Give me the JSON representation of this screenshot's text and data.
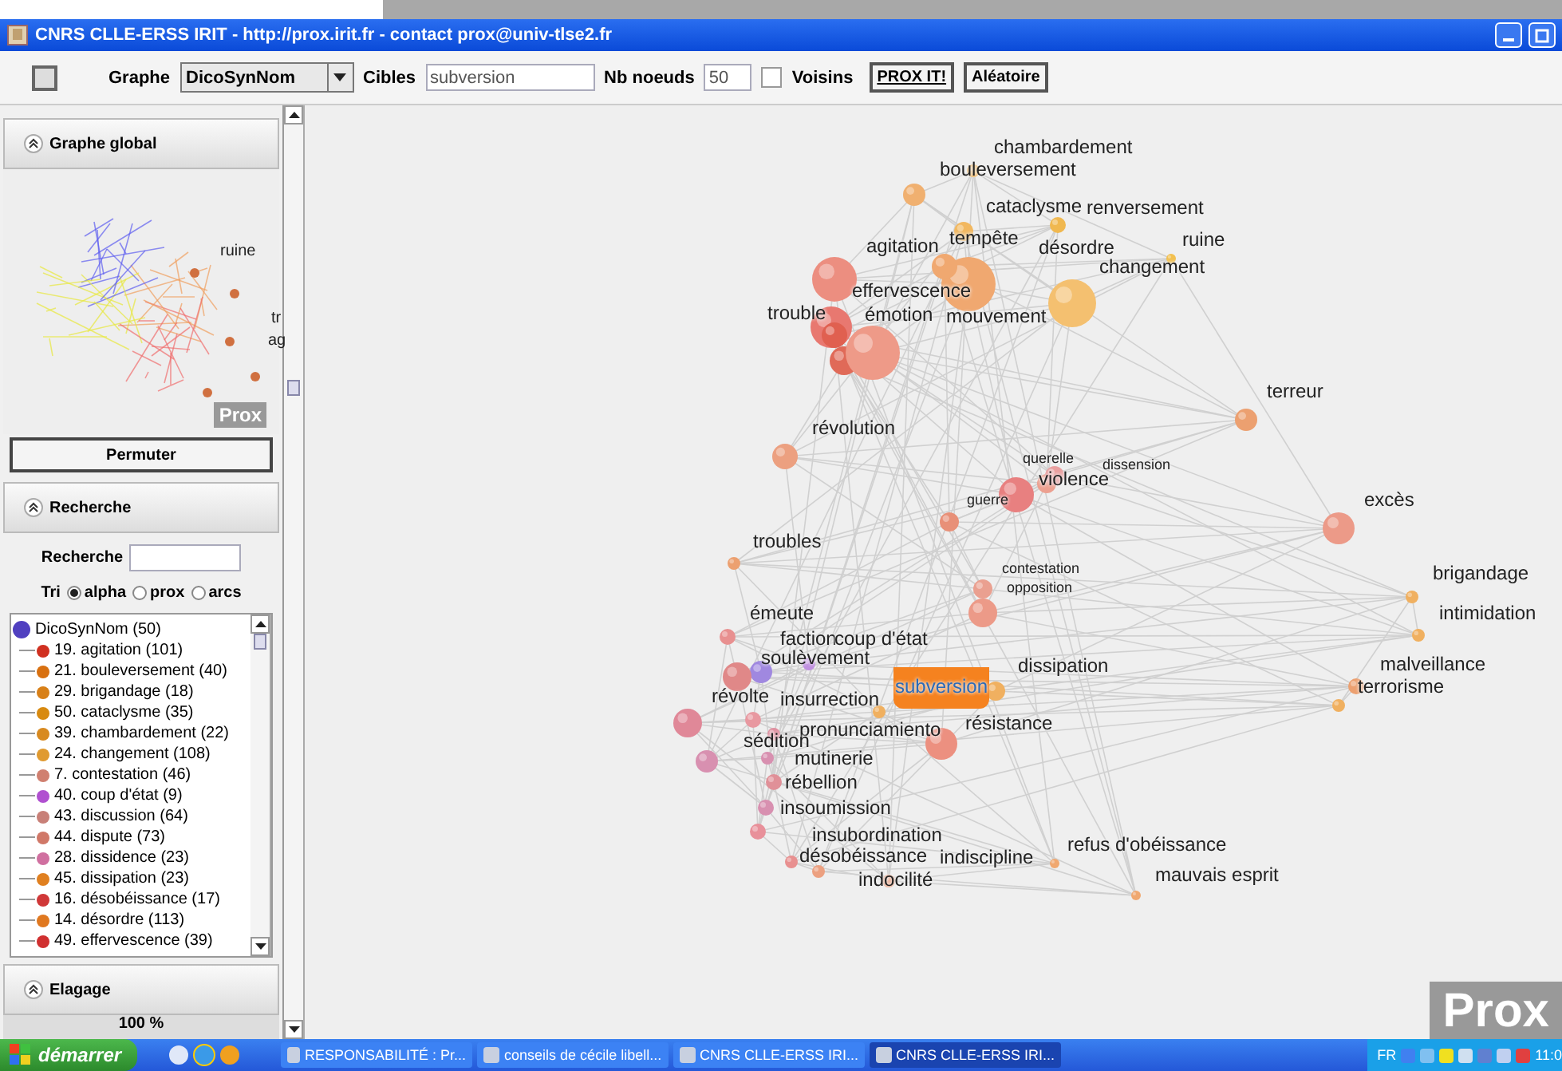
{
  "window": {
    "title": "CNRS CLLE-ERSS IRIT - http://prox.irit.fr - contact prox@univ-tlse2.fr"
  },
  "toolbar": {
    "graphe_label": "Graphe",
    "graphe_value": "DicoSynNom",
    "cibles_label": "Cibles",
    "cibles_value": "subversion",
    "nb_label": "Nb noeuds",
    "nb_value": "50",
    "voisins": {
      "label": "Voisins",
      "checked": false
    },
    "buttons": [
      "PROX IT!",
      "Aléatoire"
    ]
  },
  "sidebar": {
    "global": {
      "title": "Graphe global",
      "labels": [
        "ruine",
        "tr",
        "ag"
      ],
      "logo": "Prox",
      "button": "Permuter"
    },
    "search": {
      "title": "Recherche",
      "field_label": "Recherche",
      "sort_label": "Tri",
      "sort_options": [
        {
          "label": "alpha",
          "selected": true
        },
        {
          "label": "prox",
          "selected": false
        },
        {
          "label": "arcs",
          "selected": false
        }
      ],
      "tree": {
        "label": "DicoSynNom (50)",
        "children": [
          {
            "label": "19. agitation (101)",
            "color": "#d03020"
          },
          {
            "label": "21. bouleversement (40)",
            "color": "#d87010"
          },
          {
            "label": "29. brigandage (18)",
            "color": "#d88018"
          },
          {
            "label": "50. cataclysme (35)",
            "color": "#d88a10"
          },
          {
            "label": "39. chambardement (22)",
            "color": "#d88a20"
          },
          {
            "label": "24. changement (108)",
            "color": "#e09a30"
          },
          {
            "label": "7. contestation (46)",
            "color": "#d08070"
          },
          {
            "label": "40. coup d'état (9)",
            "color": "#b050d0"
          },
          {
            "label": "43. discussion (64)",
            "color": "#c88078"
          },
          {
            "label": "44. dispute (73)",
            "color": "#d07868"
          },
          {
            "label": "28. dissidence (23)",
            "color": "#d070a0"
          },
          {
            "label": "45. dissipation (23)",
            "color": "#e08020"
          },
          {
            "label": "16. désobéissance (17)",
            "color": "#d03838"
          },
          {
            "label": "14. désordre (113)",
            "color": "#e07820"
          },
          {
            "label": "49. effervescence (39)",
            "color": "#d03030"
          }
        ]
      }
    },
    "pruning": {
      "title": "Elagage",
      "value": "100 %"
    }
  },
  "graph": {
    "logo": "Prox",
    "nodes": [
      {
        "label": "chambardement",
        "color": "#f2b860",
        "selected": false
      },
      {
        "label": "bouleversement",
        "color": "#f0b070",
        "selected": false
      },
      {
        "label": "cataclysme",
        "color": "#f2b860",
        "selected": false
      },
      {
        "label": "renversement",
        "color": "#f0b850",
        "selected": false
      },
      {
        "label": "agitation",
        "color": "#ec8e80",
        "selected": false
      },
      {
        "label": "tempête",
        "color": "#f0a870",
        "selected": false
      },
      {
        "label": "désordre",
        "color": "#f0a870",
        "selected": false
      },
      {
        "label": "ruine",
        "color": "#f2c050",
        "selected": false
      },
      {
        "label": "changement",
        "color": "#f4c070",
        "selected": false
      },
      {
        "label": "effervescence",
        "color": "#e87870",
        "selected": false
      },
      {
        "label": "trouble",
        "color": "#e06050",
        "selected": false
      },
      {
        "label": "émotion",
        "color": "#e06a58",
        "selected": false
      },
      {
        "label": "mouvement",
        "color": "#ee9a88",
        "selected": false
      },
      {
        "label": "terreur",
        "color": "#eca070",
        "selected": false
      },
      {
        "label": "révolution",
        "color": "#eca080",
        "selected": false
      },
      {
        "label": "querelle",
        "color": "#eca090",
        "selected": false
      },
      {
        "label": "dissension",
        "color": "#eaa0a0",
        "selected": false
      },
      {
        "label": "violence",
        "color": "#e88080",
        "selected": false
      },
      {
        "label": "guerre",
        "color": "#e89078",
        "selected": false
      },
      {
        "label": "excès",
        "color": "#ec9a88",
        "selected": false
      },
      {
        "label": "troubles",
        "color": "#eca070",
        "selected": false
      },
      {
        "label": "contestation",
        "color": "#eaa090",
        "selected": false
      },
      {
        "label": "opposition",
        "color": "#ec9a88",
        "selected": false
      },
      {
        "label": "brigandage",
        "color": "#f0b060",
        "selected": false
      },
      {
        "label": "intimidation",
        "color": "#f0b060",
        "selected": false
      },
      {
        "label": "émeute",
        "color": "#e89090",
        "selected": false
      },
      {
        "label": "faction",
        "color": "#c090e0",
        "selected": false
      },
      {
        "label": "coup d'état",
        "color": "#a088e0",
        "selected": false
      },
      {
        "label": "soulèvement",
        "color": "#e08888",
        "selected": false
      },
      {
        "label": "malveillance",
        "color": "#eca070",
        "selected": false
      },
      {
        "label": "terrorisme",
        "color": "#f0b060",
        "selected": false
      },
      {
        "label": "dissipation",
        "color": "#f0b060",
        "selected": false
      },
      {
        "label": "subversion",
        "color": "#f0b060",
        "selected": true
      },
      {
        "label": "révolte",
        "color": "#e08898",
        "selected": false
      },
      {
        "label": "insurrection",
        "color": "#e898a0",
        "selected": false
      },
      {
        "label": "résistance",
        "color": "#ec9080",
        "selected": false
      },
      {
        "label": "pronunciamiento",
        "color": "#e090a0",
        "selected": false
      },
      {
        "label": "sédition",
        "color": "#d890b0",
        "selected": false
      },
      {
        "label": "mutinerie",
        "color": "#d890b0",
        "selected": false
      },
      {
        "label": "rébellion",
        "color": "#e09098",
        "selected": false
      },
      {
        "label": "insoumission",
        "color": "#d890b0",
        "selected": false
      },
      {
        "label": "insubordination",
        "color": "#e8909a",
        "selected": false
      },
      {
        "label": "désobéissance",
        "color": "#e89090",
        "selected": false
      },
      {
        "label": "indiscipline",
        "color": "#eca080",
        "selected": false
      },
      {
        "label": "refus d'obéissance",
        "color": "#f0a870",
        "selected": false
      },
      {
        "label": "indocilité",
        "color": "#eca080",
        "selected": false
      },
      {
        "label": "mauvais esprit",
        "color": "#f0a870",
        "selected": false
      }
    ]
  },
  "taskbar": {
    "start": "démarrer",
    "tasks": [
      {
        "label": "RESPONSABILITÉ : Pr...",
        "selected": false
      },
      {
        "label": "conseils de cécile libell...",
        "selected": false
      },
      {
        "label": "CNRS CLLE-ERSS IRI...",
        "selected": false
      },
      {
        "label": "CNRS CLLE-ERSS IRI...",
        "selected": true
      }
    ],
    "lang": "FR",
    "clock": "11:0"
  }
}
